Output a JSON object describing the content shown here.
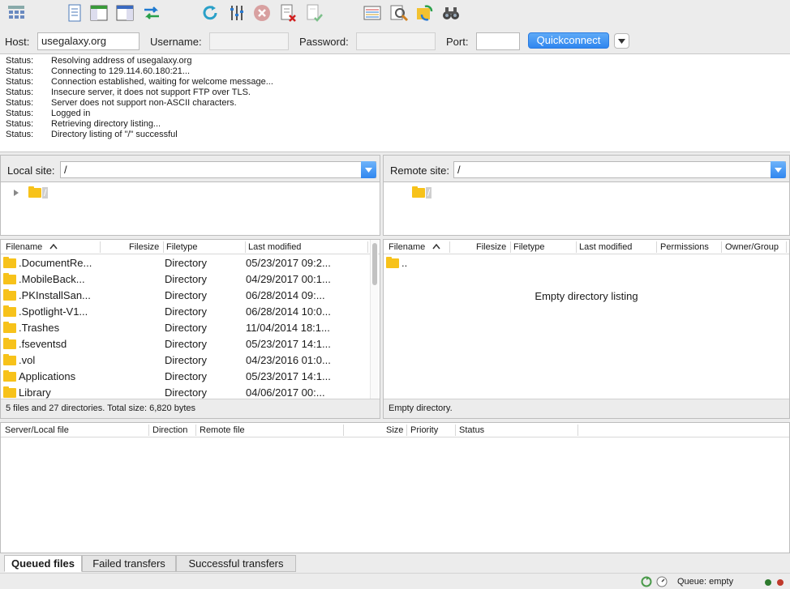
{
  "toolbar": {
    "icons": [
      "site-manager-icon",
      "message-log-icon",
      "local-tree-icon",
      "remote-tree-icon",
      "transfer-queue-icon",
      "refresh-icon",
      "filter-icon",
      "cancel-icon",
      "disconnect-icon",
      "reconnect-icon",
      "compare-icon",
      "search-remote-icon",
      "sync-browse-icon",
      "find-files-icon"
    ]
  },
  "quickconnect": {
    "host_label": "Host:",
    "host_value": "usegalaxy.org",
    "username_label": "Username:",
    "username_value": "",
    "password_label": "Password:",
    "password_value": "",
    "port_label": "Port:",
    "port_value": "",
    "button_label": "Quickconnect"
  },
  "log": [
    {
      "label": "Status:",
      "message": "Resolving address of usegalaxy.org"
    },
    {
      "label": "Status:",
      "message": "Connecting to 129.114.60.180:21..."
    },
    {
      "label": "Status:",
      "message": "Connection established, waiting for welcome message..."
    },
    {
      "label": "Status:",
      "message": "Insecure server, it does not support FTP over TLS."
    },
    {
      "label": "Status:",
      "message": "Server does not support non-ASCII characters."
    },
    {
      "label": "Status:",
      "message": "Logged in"
    },
    {
      "label": "Status:",
      "message": "Retrieving directory listing..."
    },
    {
      "label": "Status:",
      "message": "Directory listing of \"/\" successful"
    }
  ],
  "local": {
    "site_label": "Local site:",
    "path": "/",
    "tree_root": "/",
    "headers": {
      "filename": "Filename",
      "filesize": "Filesize",
      "filetype": "Filetype",
      "modified": "Last modified"
    },
    "files": [
      {
        "name": ".DocumentRe...",
        "type": "Directory",
        "modified": "05/23/2017 09:2..."
      },
      {
        "name": ".MobileBack...",
        "type": "Directory",
        "modified": "04/29/2017 00:1..."
      },
      {
        "name": ".PKInstallSan...",
        "type": "Directory",
        "modified": "06/28/2014 09:..."
      },
      {
        "name": ".Spotlight-V1...",
        "type": "Directory",
        "modified": "06/28/2014 10:0..."
      },
      {
        "name": ".Trashes",
        "type": "Directory",
        "modified": "11/04/2014 18:1..."
      },
      {
        "name": ".fseventsd",
        "type": "Directory",
        "modified": "05/23/2017 14:1..."
      },
      {
        "name": ".vol",
        "type": "Directory",
        "modified": "04/23/2016 01:0..."
      },
      {
        "name": "Applications",
        "type": "Directory",
        "modified": "05/23/2017 14:1..."
      },
      {
        "name": "Library",
        "type": "Directory",
        "modified": "04/06/2017 00:..."
      }
    ],
    "status": "5 files and 27 directories. Total size: 6,820 bytes"
  },
  "remote": {
    "site_label": "Remote site:",
    "path": "/",
    "tree_root": "/",
    "headers": {
      "filename": "Filename",
      "filesize": "Filesize",
      "filetype": "Filetype",
      "modified": "Last modified",
      "permissions": "Permissions",
      "owner": "Owner/Group"
    },
    "parent_entry": "..",
    "empty_message": "Empty directory listing",
    "status": "Empty directory."
  },
  "queue": {
    "headers": {
      "server_local": "Server/Local file",
      "direction": "Direction",
      "remote_file": "Remote file",
      "size": "Size",
      "priority": "Priority",
      "status": "Status"
    }
  },
  "tabs": [
    "Queued files",
    "Failed transfers",
    "Successful transfers"
  ],
  "statusbar": {
    "queue": "Queue: empty"
  },
  "colors": {
    "accent": "#2f86ef",
    "folder": "#f7c21a"
  }
}
